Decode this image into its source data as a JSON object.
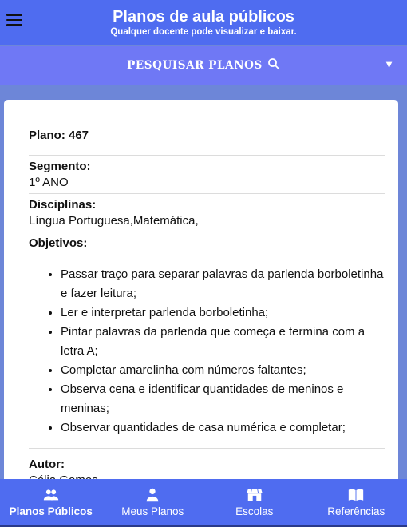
{
  "header": {
    "title": "Planos de aula públicos",
    "subtitle": "Qualquer docente pode visualizar e baixar."
  },
  "search": {
    "label": "PESQUISAR PLANOS",
    "icon": "search-icon",
    "dropdown_icon": "caret-down-icon"
  },
  "plan": {
    "title": "Plano: 467",
    "segment_label": "Segmento:",
    "segment_value": "1º ANO",
    "disciplines_label": "Disciplinas:",
    "disciplines_value": "Língua Portuguesa,Matemática,",
    "objectives_label": "Objetivos:",
    "objectives": [
      "Passar traço para separar palavras da parlenda borboletinha e fazer leitura;",
      "Ler e interpretar parlenda borboletinha;",
      "Pintar palavras da parlenda que começa e termina com a letra A;",
      "Completar amarelinha com números faltantes;",
      "Observa cena e identificar quantidades de meninos e meninas;",
      "Observar quantidades de casa numérica e completar;"
    ],
    "author_label": "Autor:",
    "author_value": "Célia Gomes"
  },
  "bottom_nav": {
    "items": [
      {
        "label": "Planos Públicos",
        "icon": "people-icon",
        "active": true
      },
      {
        "label": "Meus Planos",
        "icon": "person-icon",
        "active": false
      },
      {
        "label": "Escolas",
        "icon": "school-icon",
        "active": false
      },
      {
        "label": "Referências",
        "icon": "book-icon",
        "active": false
      }
    ]
  },
  "colors": {
    "header": "#4f6cf0",
    "search_bar": "#6f78f5",
    "background": "#6d86d8"
  }
}
